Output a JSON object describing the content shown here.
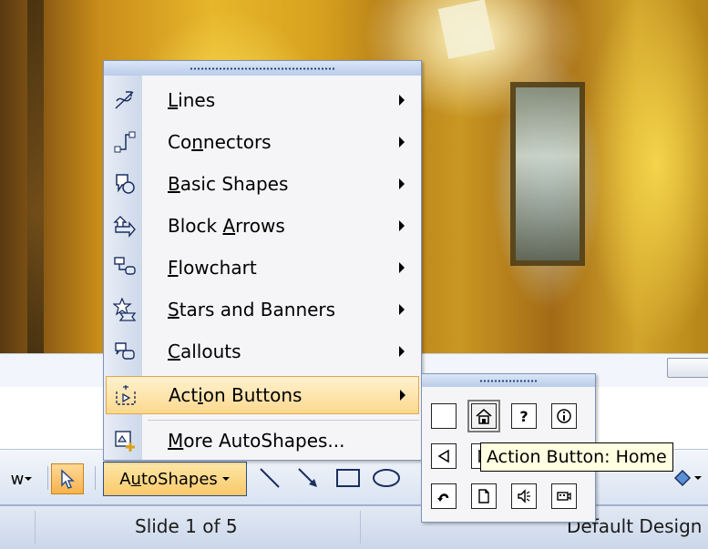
{
  "menu": {
    "items": [
      {
        "label": "Lines",
        "icon": "lines-icon",
        "has_submenu": true,
        "mnemonic": "L"
      },
      {
        "label": "Connectors",
        "icon": "connectors-icon",
        "has_submenu": true,
        "mnemonic": "n"
      },
      {
        "label": "Basic Shapes",
        "icon": "basic-shapes-icon",
        "has_submenu": true,
        "mnemonic": "B"
      },
      {
        "label": "Block Arrows",
        "icon": "block-arrows-icon",
        "has_submenu": true,
        "mnemonic": "A"
      },
      {
        "label": "Flowchart",
        "icon": "flowchart-icon",
        "has_submenu": true,
        "mnemonic": "F"
      },
      {
        "label": "Stars and Banners",
        "icon": "stars-banners-icon",
        "has_submenu": true,
        "mnemonic": "S"
      },
      {
        "label": "Callouts",
        "icon": "callouts-icon",
        "has_submenu": true,
        "mnemonic": "C"
      },
      {
        "label": "Action Buttons",
        "icon": "action-buttons-icon",
        "has_submenu": true,
        "mnemonic": "i",
        "active": true
      },
      {
        "label": "More AutoShapes...",
        "icon": "more-autoshapes-icon",
        "has_submenu": false,
        "mnemonic": "M"
      }
    ]
  },
  "action_buttons": [
    {
      "name": "action-button-custom",
      "glyph": ""
    },
    {
      "name": "action-button-home",
      "glyph": "⌂",
      "hovered": true
    },
    {
      "name": "action-button-help",
      "glyph": "?"
    },
    {
      "name": "action-button-information",
      "glyph": "ⓘ"
    },
    {
      "name": "action-button-back",
      "glyph": "◁"
    },
    {
      "name": "action-button-forward",
      "glyph": "▷"
    },
    {
      "name": "action-button-beginning",
      "glyph": "|◁"
    },
    {
      "name": "action-button-end",
      "glyph": "▷|"
    },
    {
      "name": "action-button-return",
      "glyph": "↶"
    },
    {
      "name": "action-button-document",
      "glyph": "🗋"
    },
    {
      "name": "action-button-sound",
      "glyph": "🔈"
    },
    {
      "name": "action-button-movie",
      "glyph": "🎞"
    }
  ],
  "tooltip": {
    "text": "Action Button: Home"
  },
  "toolbar": {
    "draw_label": "w",
    "autoshapes_label": "AutoShapes",
    "autoshapes_mnemonic": "u"
  },
  "status": {
    "slide_counter": "Slide 1 of 5",
    "design_name": "Default Design"
  },
  "colors": {
    "menu_highlight": "#fcd88e",
    "toolbar_accent": "#f9c96a",
    "tooltip_bg": "#ffffe1"
  }
}
